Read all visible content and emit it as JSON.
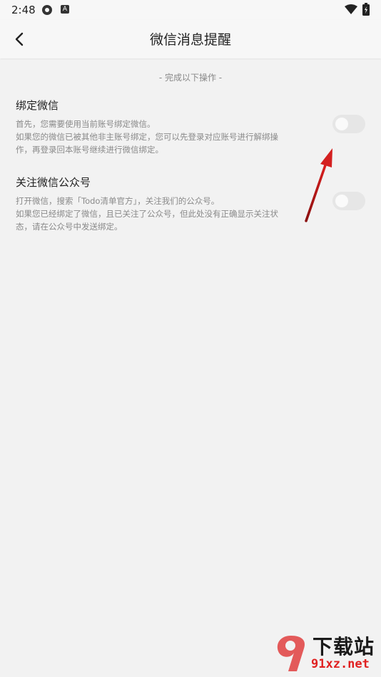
{
  "status_bar": {
    "time": "2:48",
    "icon_b_letter": "A"
  },
  "header": {
    "title": "微信消息提醒"
  },
  "hint": "- 完成以下操作 -",
  "settings": [
    {
      "title": "绑定微信",
      "desc_lines": [
        "首先，您需要使用当前账号绑定微信。",
        "如果您的微信已被其他非主账号绑定，您可以先登录对应账号进行解绑操",
        "作，再登录回本账号继续进行微信绑定。"
      ],
      "toggle_on": false
    },
    {
      "title": "关注微信公众号",
      "desc_lines": [
        "打开微信，搜索「Todo清单官方」，关注我们的公众号。",
        "如果您已经绑定了微信，且已关注了公众号，但此处没有正确显示关注状",
        "态，请在公众号中发送绑定。"
      ],
      "toggle_on": false
    }
  ],
  "watermark": {
    "main": "下载站",
    "sub": "91xz.net"
  },
  "colors": {
    "arrow": "#d42020",
    "toggle_off": "#e6e6e6"
  }
}
